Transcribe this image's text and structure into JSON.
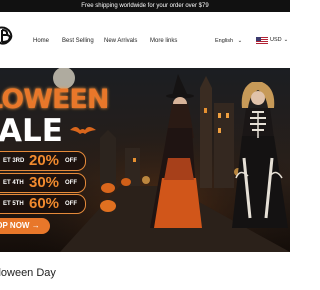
{
  "announcement": "Free shipping worldwide for your order over $79",
  "nav": {
    "items": [
      "Home",
      "Best Selling",
      "New Arrivals",
      "More links"
    ],
    "language": "English",
    "currency": "USD"
  },
  "hero": {
    "title_line1": "LOWEEN",
    "title_line2": "ALE",
    "deals": [
      {
        "label": "ET 3RD",
        "percent": "20%",
        "off": "OFF"
      },
      {
        "label": "ET 4TH",
        "percent": "30%",
        "off": "OFF"
      },
      {
        "label": "ET 5TH",
        "percent": "60%",
        "off": "OFF"
      }
    ],
    "cta": "OP NOW"
  },
  "section": {
    "title": "lloween Day"
  },
  "colors": {
    "accent": "#e8772a",
    "hero_bg": "#1a1410",
    "topbar": "#111111"
  }
}
